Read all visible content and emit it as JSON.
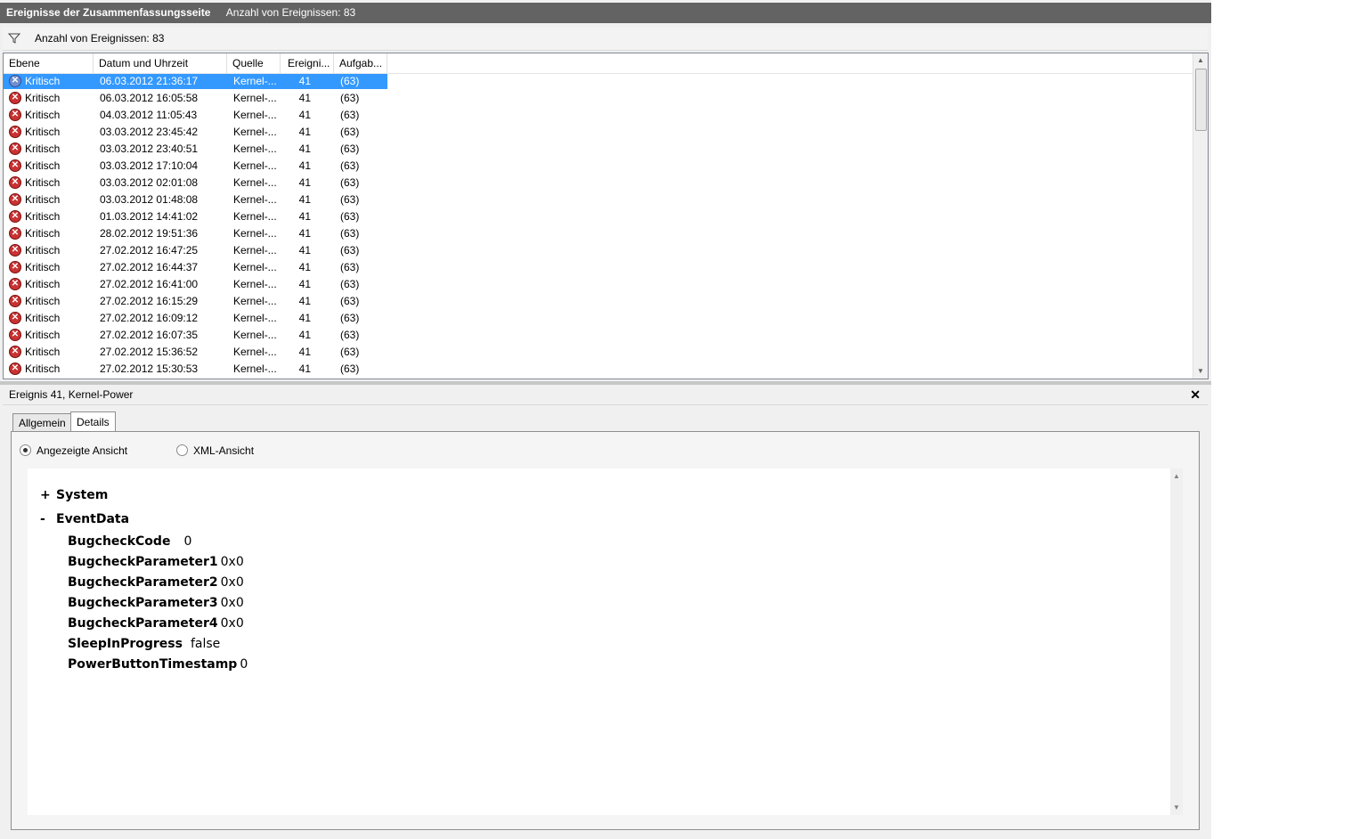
{
  "titlebar": {
    "title": "Ereignisse der Zusammenfassungsseite",
    "count": "Anzahl von Ereignissen: 83"
  },
  "filterbar": {
    "icon": "filter-icon",
    "text": "Anzahl von Ereignissen: 83"
  },
  "table": {
    "columns": [
      "Ebene",
      "Datum und Uhrzeit",
      "Quelle",
      "Ereigni...",
      "Aufgab..."
    ],
    "rows": [
      {
        "level": "Kritisch",
        "datetime": "06.03.2012 21:36:17",
        "source": "Kernel-...",
        "event": "41",
        "task": "(63)",
        "selected": true
      },
      {
        "level": "Kritisch",
        "datetime": "06.03.2012 16:05:58",
        "source": "Kernel-...",
        "event": "41",
        "task": "(63)"
      },
      {
        "level": "Kritisch",
        "datetime": "04.03.2012 11:05:43",
        "source": "Kernel-...",
        "event": "41",
        "task": "(63)"
      },
      {
        "level": "Kritisch",
        "datetime": "03.03.2012 23:45:42",
        "source": "Kernel-...",
        "event": "41",
        "task": "(63)"
      },
      {
        "level": "Kritisch",
        "datetime": "03.03.2012 23:40:51",
        "source": "Kernel-...",
        "event": "41",
        "task": "(63)"
      },
      {
        "level": "Kritisch",
        "datetime": "03.03.2012 17:10:04",
        "source": "Kernel-...",
        "event": "41",
        "task": "(63)"
      },
      {
        "level": "Kritisch",
        "datetime": "03.03.2012 02:01:08",
        "source": "Kernel-...",
        "event": "41",
        "task": "(63)"
      },
      {
        "level": "Kritisch",
        "datetime": "03.03.2012 01:48:08",
        "source": "Kernel-...",
        "event": "41",
        "task": "(63)"
      },
      {
        "level": "Kritisch",
        "datetime": "01.03.2012 14:41:02",
        "source": "Kernel-...",
        "event": "41",
        "task": "(63)"
      },
      {
        "level": "Kritisch",
        "datetime": "28.02.2012 19:51:36",
        "source": "Kernel-...",
        "event": "41",
        "task": "(63)"
      },
      {
        "level": "Kritisch",
        "datetime": "27.02.2012 16:47:25",
        "source": "Kernel-...",
        "event": "41",
        "task": "(63)"
      },
      {
        "level": "Kritisch",
        "datetime": "27.02.2012 16:44:37",
        "source": "Kernel-...",
        "event": "41",
        "task": "(63)"
      },
      {
        "level": "Kritisch",
        "datetime": "27.02.2012 16:41:00",
        "source": "Kernel-...",
        "event": "41",
        "task": "(63)"
      },
      {
        "level": "Kritisch",
        "datetime": "27.02.2012 16:15:29",
        "source": "Kernel-...",
        "event": "41",
        "task": "(63)"
      },
      {
        "level": "Kritisch",
        "datetime": "27.02.2012 16:09:12",
        "source": "Kernel-...",
        "event": "41",
        "task": "(63)"
      },
      {
        "level": "Kritisch",
        "datetime": "27.02.2012 16:07:35",
        "source": "Kernel-...",
        "event": "41",
        "task": "(63)"
      },
      {
        "level": "Kritisch",
        "datetime": "27.02.2012 15:36:52",
        "source": "Kernel-...",
        "event": "41",
        "task": "(63)"
      },
      {
        "level": "Kritisch",
        "datetime": "27.02.2012 15:30:53",
        "source": "Kernel-...",
        "event": "41",
        "task": "(63)"
      }
    ]
  },
  "detail": {
    "title": "Ereignis 41, Kernel-Power",
    "close": "✕",
    "tabs": [
      "Allgemein",
      "Details"
    ],
    "active_tab": "Details",
    "radio_display": "Angezeigte Ansicht",
    "radio_xml": "XML-Ansicht",
    "selected_view": "Angezeigte Ansicht",
    "tree": {
      "system": {
        "toggle": "+",
        "label": "System"
      },
      "eventdata": {
        "toggle": "-",
        "label": "EventData",
        "fields": [
          {
            "key": "BugcheckCode",
            "value": "0"
          },
          {
            "key": "BugcheckParameter1",
            "value": "0x0"
          },
          {
            "key": "BugcheckParameter2",
            "value": "0x0"
          },
          {
            "key": "BugcheckParameter3",
            "value": "0x0"
          },
          {
            "key": "BugcheckParameter4",
            "value": "0x0"
          },
          {
            "key": "SleepInProgress",
            "value": "false"
          },
          {
            "key": "PowerButtonTimestamp",
            "value": "0"
          }
        ]
      }
    }
  },
  "colors": {
    "selection": "#3399ff",
    "critical": "#c83232",
    "titlebar": "#636363"
  }
}
